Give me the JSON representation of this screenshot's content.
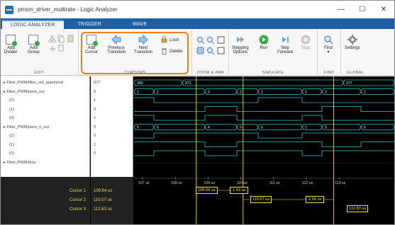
{
  "window": {
    "title": "pmsm_driver_multirate - Logic Analyzer",
    "minimize": "—",
    "maximize": "☐",
    "close": "✕"
  },
  "tabs": [
    "LOGIC ANALYZER",
    "TRIGGER",
    "WAVE"
  ],
  "toolstrip": {
    "edit": {
      "label": "EDIT",
      "add_divider": [
        "Add",
        "Divider"
      ],
      "add_group": [
        "Add",
        "Group"
      ]
    },
    "cursors": {
      "label": "CURSORS",
      "add_cursor": [
        "Add",
        "Cursor"
      ],
      "previous_transition": [
        "Previous",
        "Transition"
      ],
      "next_transition": [
        "Next",
        "Transition"
      ],
      "lock": "Lock",
      "delete": "Delete"
    },
    "zoom_pan": {
      "label": "ZOOM & PAN"
    },
    "simulate": {
      "label": "SIMULATE",
      "stepping_options": [
        "Stepping",
        "Options"
      ],
      "run": "Run",
      "step_forward": [
        "Step",
        "Forward"
      ],
      "stop": "Stop"
    },
    "find": {
      "label": "FIND",
      "find": "Find"
    },
    "global": {
      "label": "GLOBAL",
      "settings": "Settings"
    }
  },
  "signals": [
    {
      "name": "Filter_PWM/filter_out_quantized",
      "value": "377",
      "sub": false
    },
    {
      "name": "Filter_PWM/pwm_out",
      "value": "5",
      "sub": false
    },
    {
      "name": "(2)",
      "value": "1",
      "sub": true
    },
    {
      "name": "(1)",
      "value": "0",
      "sub": true
    },
    {
      "name": "(0)",
      "value": "1",
      "sub": true
    },
    {
      "name": "Filter_PWM/pwm_n_out",
      "value": "2",
      "sub": false
    },
    {
      "name": "(2)",
      "value": "0",
      "sub": true
    },
    {
      "name": "(1)",
      "value": "1",
      "sub": true
    },
    {
      "name": "(0)",
      "value": "0",
      "sub": true
    },
    {
      "name": "Filter_PWM/duty",
      "value": "",
      "sub": false
    }
  ],
  "bus_values": {
    "row0": [
      "380",
      "371",
      "377"
    ],
    "row1": [
      "2",
      "1",
      "3",
      "2",
      "1",
      "5",
      "2",
      "1"
    ],
    "row5": [
      "5",
      "6",
      "4",
      "5",
      "6",
      "2",
      "5",
      "6"
    ]
  },
  "axis_ticks": [
    "107 us",
    "108 us",
    "109 us",
    "110 us",
    "111 us",
    "112 us",
    "113 us"
  ],
  "cursors": [
    {
      "name": "Cursor 1",
      "value": "108.64 us",
      "color": "#e5d84a"
    },
    {
      "name": "Cursor 2",
      "value": "110.07 us",
      "color": "#e5d84a"
    },
    {
      "name": "Cursor 3",
      "value": "112.83 us",
      "color": "#e5d84a"
    }
  ],
  "deltas": [
    "1.43 us",
    "2.56 us"
  ],
  "colors": {
    "trace": "#2fc4c4",
    "cursor": "#f0e040",
    "highlight": "#f07d19",
    "tab_bar": "#1f5fa4"
  }
}
